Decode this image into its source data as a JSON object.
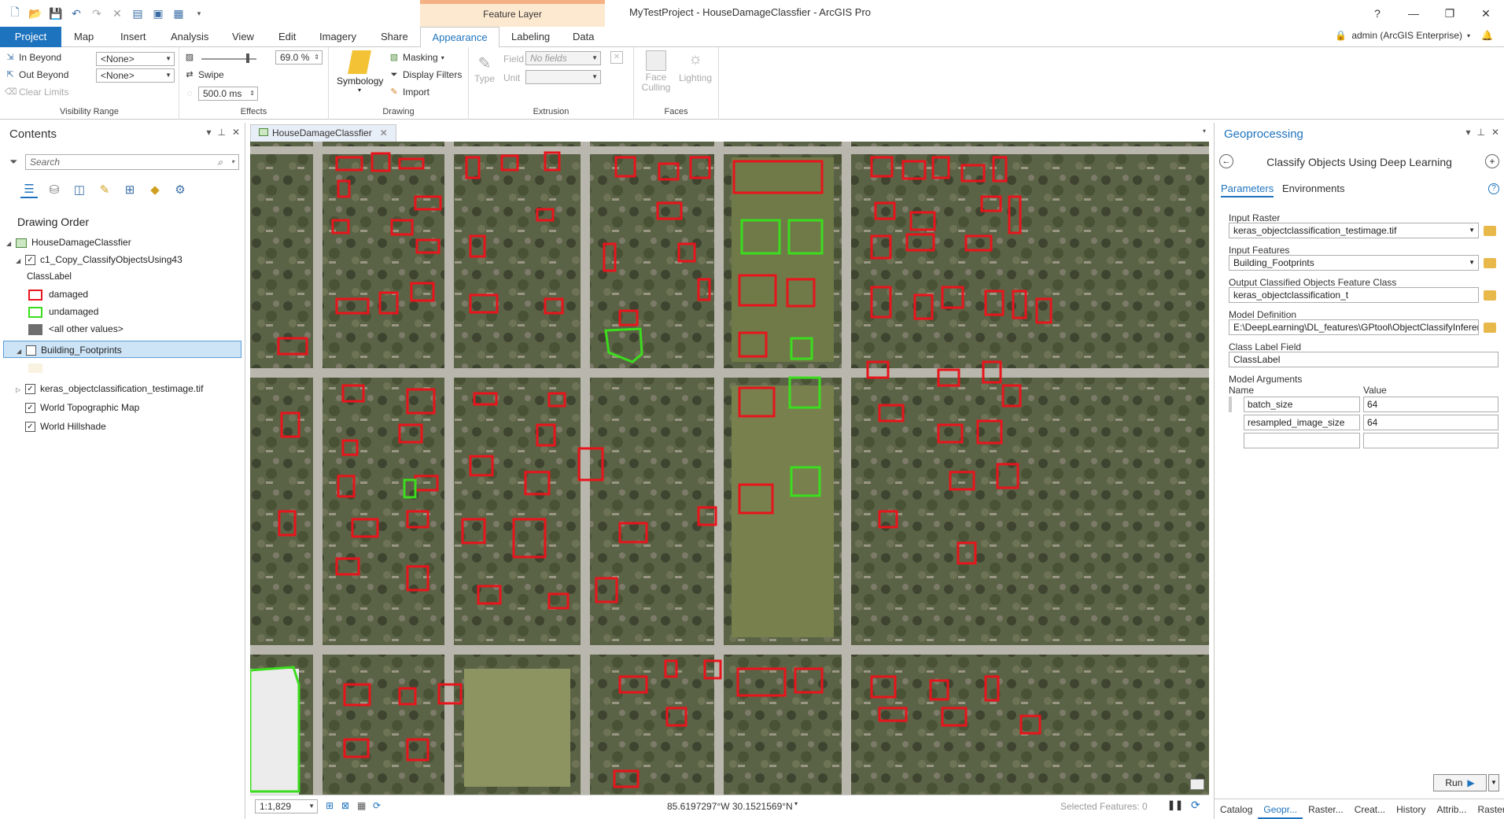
{
  "title_bar": {
    "app_title": "MyTestProject - HouseDamageClassfier - ArcGIS Pro",
    "context_tab": "Feature Layer",
    "help": "?"
  },
  "tabs": [
    "Project",
    "Map",
    "Insert",
    "Analysis",
    "View",
    "Edit",
    "Imagery",
    "Share",
    "Appearance",
    "Labeling",
    "Data"
  ],
  "active_tab": "Appearance",
  "user": "admin (ArcGIS Enterprise)",
  "ribbon": {
    "visibility": {
      "in_beyond": "In Beyond",
      "out_beyond": "Out Beyond",
      "clear_limits": "Clear Limits",
      "in_value": "<None>",
      "out_value": "<None>",
      "label": "Visibility Range"
    },
    "effects": {
      "transparency": "69.0  %",
      "swipe": "Swipe",
      "flicker": "500.0  ms",
      "label": "Effects"
    },
    "drawing": {
      "symbology": "Symbology",
      "masking": "Masking",
      "display_filters": "Display Filters",
      "import": "Import",
      "label": "Drawing"
    },
    "extrusion": {
      "type": "Type",
      "field": "Field",
      "field_value": "No fields",
      "unit": "Unit",
      "label": "Extrusion"
    },
    "faces": {
      "face_culling": "Face Culling",
      "lighting": "Lighting",
      "label": "Faces"
    }
  },
  "contents": {
    "title": "Contents",
    "search_placeholder": "Search",
    "drawing_order": "Drawing Order",
    "map_name": "HouseDamageClassfier",
    "layer1": "c1_Copy_ClassifyObjectsUsing43",
    "class_label": "ClassLabel",
    "legend": [
      {
        "label": "damaged",
        "color": "#e8141c"
      },
      {
        "label": "undamaged",
        "color": "#3cdc1e"
      },
      {
        "label": "<all other values>",
        "color": "#6e6e6e"
      }
    ],
    "layer2": "Building_Footprints",
    "layer3": "keras_objectclassification_testimage.tif",
    "layer4": "World Topographic Map",
    "layer5": "World Hillshade"
  },
  "map": {
    "tab_label": "HouseDamageClassfier",
    "scale": "1:1,829",
    "coordinates": "85.6197297°W 30.1521569°N",
    "selected_features": "Selected Features: 0"
  },
  "geoprocessing": {
    "title": "Geoprocessing",
    "tool_title": "Classify Objects Using Deep Learning",
    "tab_parameters": "Parameters",
    "tab_environments": "Environments",
    "input_raster_label": "Input Raster",
    "input_raster": "keras_objectclassification_testimage.tif",
    "input_features_label": "Input Features",
    "input_features": "Building_Footprints",
    "output_label": "Output Classified Objects Feature Class",
    "output": "keras_objectclassification_t",
    "model_def_label": "Model Definition",
    "model_def": "E:\\DeepLearning\\DL_features\\GPtool\\ObjectClassifyInferen",
    "class_field_label": "Class Label Field",
    "class_field": "ClassLabel",
    "model_args_label": "Model Arguments",
    "col_name": "Name",
    "col_value": "Value",
    "args": [
      {
        "name": "batch_size",
        "value": "64"
      },
      {
        "name": "resampled_image_size",
        "value": "64"
      }
    ],
    "run": "Run",
    "bottom_tabs": [
      "Catalog",
      "Geopr...",
      "Raster...",
      "Creat...",
      "History",
      "Attrib...",
      "Raster..."
    ]
  }
}
